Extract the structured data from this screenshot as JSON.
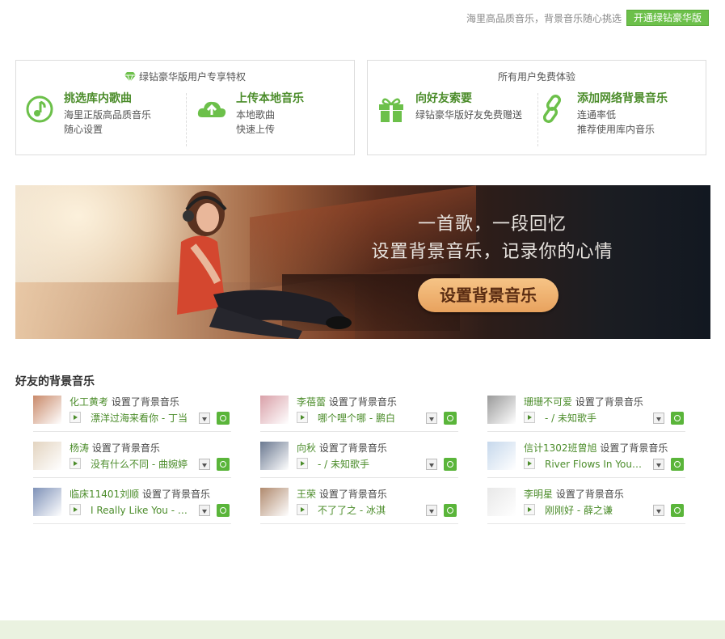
{
  "topbar": {
    "promo_text": "海里高品质音乐，背景音乐随心挑选",
    "vip_button": "开通绿钻豪华版"
  },
  "vip_box": {
    "header": "绿钻豪华版用户专享特权",
    "features": [
      {
        "icon": "music-note-icon",
        "title": "挑选库内歌曲",
        "desc1": "海里正版高品质音乐",
        "desc2": "随心设置"
      },
      {
        "icon": "cloud-upload-icon",
        "title": "上传本地音乐",
        "desc1": "本地歌曲",
        "desc2": "快速上传"
      }
    ]
  },
  "free_box": {
    "header": "所有用户免费体验",
    "features": [
      {
        "icon": "gift-icon",
        "title": "向好友索要",
        "desc1": "绿钻豪华版好友免费赠送",
        "desc2": ""
      },
      {
        "icon": "link-icon",
        "title": "添加网络背景音乐",
        "desc1": "连通率低",
        "desc2": "推荐使用库内音乐"
      }
    ]
  },
  "banner": {
    "line1": "一首歌，一段回忆",
    "line2": "设置背景音乐，记录你的心情",
    "button": "设置背景音乐"
  },
  "friends": {
    "title": "好友的背景音乐",
    "action": "设置了背景音乐",
    "items": [
      {
        "name": "化工黄考",
        "song": "漂洋过海来看你 - 丁当",
        "avatar_color": "#c98a6a"
      },
      {
        "name": "李蓓蕾",
        "song": "哪个哩个哪 - 鹏白",
        "avatar_color": "#d9a0a8"
      },
      {
        "name": "珊珊不可爱",
        "song": "- / 未知歌手",
        "avatar_color": "#9a9a9a"
      },
      {
        "name": "杨涛",
        "song": "没有什么不同 - 曲婉婷",
        "avatar_color": "#e3d4c0"
      },
      {
        "name": "向秋",
        "song": "- / 未知歌手",
        "avatar_color": "#6a7890"
      },
      {
        "name": "信计1302班曾旭",
        "song": "River Flows In You - ..",
        "avatar_color": "#c6d8ec"
      },
      {
        "name": "临床11401刘顺",
        "song": "I Really Like You - Car",
        "avatar_color": "#7f92b8"
      },
      {
        "name": "王荣",
        "song": "不了了之 - 冰淇",
        "avatar_color": "#b08a6e"
      },
      {
        "name": "李明星",
        "song": "刚刚好 - 薛之谦",
        "avatar_color": "#e8e8e8"
      }
    ]
  },
  "colors": {
    "accent_green": "#4b8c2a",
    "button_green": "#6cc04a",
    "footer_band": "#eaf2e0"
  }
}
